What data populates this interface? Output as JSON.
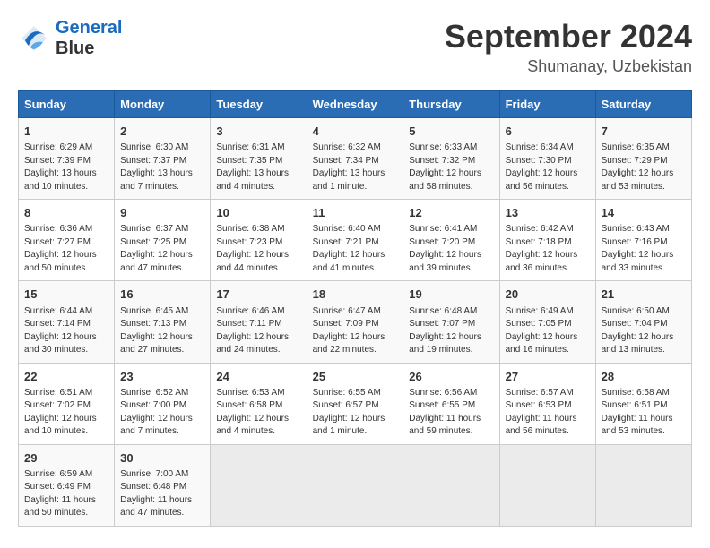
{
  "header": {
    "logo_line1": "General",
    "logo_line2": "Blue",
    "month": "September 2024",
    "location": "Shumanay, Uzbekistan"
  },
  "weekdays": [
    "Sunday",
    "Monday",
    "Tuesday",
    "Wednesday",
    "Thursday",
    "Friday",
    "Saturday"
  ],
  "weeks": [
    [
      {
        "day": "1",
        "info": "Sunrise: 6:29 AM\nSunset: 7:39 PM\nDaylight: 13 hours\nand 10 minutes."
      },
      {
        "day": "2",
        "info": "Sunrise: 6:30 AM\nSunset: 7:37 PM\nDaylight: 13 hours\nand 7 minutes."
      },
      {
        "day": "3",
        "info": "Sunrise: 6:31 AM\nSunset: 7:35 PM\nDaylight: 13 hours\nand 4 minutes."
      },
      {
        "day": "4",
        "info": "Sunrise: 6:32 AM\nSunset: 7:34 PM\nDaylight: 13 hours\nand 1 minute."
      },
      {
        "day": "5",
        "info": "Sunrise: 6:33 AM\nSunset: 7:32 PM\nDaylight: 12 hours\nand 58 minutes."
      },
      {
        "day": "6",
        "info": "Sunrise: 6:34 AM\nSunset: 7:30 PM\nDaylight: 12 hours\nand 56 minutes."
      },
      {
        "day": "7",
        "info": "Sunrise: 6:35 AM\nSunset: 7:29 PM\nDaylight: 12 hours\nand 53 minutes."
      }
    ],
    [
      {
        "day": "8",
        "info": "Sunrise: 6:36 AM\nSunset: 7:27 PM\nDaylight: 12 hours\nand 50 minutes."
      },
      {
        "day": "9",
        "info": "Sunrise: 6:37 AM\nSunset: 7:25 PM\nDaylight: 12 hours\nand 47 minutes."
      },
      {
        "day": "10",
        "info": "Sunrise: 6:38 AM\nSunset: 7:23 PM\nDaylight: 12 hours\nand 44 minutes."
      },
      {
        "day": "11",
        "info": "Sunrise: 6:40 AM\nSunset: 7:21 PM\nDaylight: 12 hours\nand 41 minutes."
      },
      {
        "day": "12",
        "info": "Sunrise: 6:41 AM\nSunset: 7:20 PM\nDaylight: 12 hours\nand 39 minutes."
      },
      {
        "day": "13",
        "info": "Sunrise: 6:42 AM\nSunset: 7:18 PM\nDaylight: 12 hours\nand 36 minutes."
      },
      {
        "day": "14",
        "info": "Sunrise: 6:43 AM\nSunset: 7:16 PM\nDaylight: 12 hours\nand 33 minutes."
      }
    ],
    [
      {
        "day": "15",
        "info": "Sunrise: 6:44 AM\nSunset: 7:14 PM\nDaylight: 12 hours\nand 30 minutes."
      },
      {
        "day": "16",
        "info": "Sunrise: 6:45 AM\nSunset: 7:13 PM\nDaylight: 12 hours\nand 27 minutes."
      },
      {
        "day": "17",
        "info": "Sunrise: 6:46 AM\nSunset: 7:11 PM\nDaylight: 12 hours\nand 24 minutes."
      },
      {
        "day": "18",
        "info": "Sunrise: 6:47 AM\nSunset: 7:09 PM\nDaylight: 12 hours\nand 22 minutes."
      },
      {
        "day": "19",
        "info": "Sunrise: 6:48 AM\nSunset: 7:07 PM\nDaylight: 12 hours\nand 19 minutes."
      },
      {
        "day": "20",
        "info": "Sunrise: 6:49 AM\nSunset: 7:05 PM\nDaylight: 12 hours\nand 16 minutes."
      },
      {
        "day": "21",
        "info": "Sunrise: 6:50 AM\nSunset: 7:04 PM\nDaylight: 12 hours\nand 13 minutes."
      }
    ],
    [
      {
        "day": "22",
        "info": "Sunrise: 6:51 AM\nSunset: 7:02 PM\nDaylight: 12 hours\nand 10 minutes."
      },
      {
        "day": "23",
        "info": "Sunrise: 6:52 AM\nSunset: 7:00 PM\nDaylight: 12 hours\nand 7 minutes."
      },
      {
        "day": "24",
        "info": "Sunrise: 6:53 AM\nSunset: 6:58 PM\nDaylight: 12 hours\nand 4 minutes."
      },
      {
        "day": "25",
        "info": "Sunrise: 6:55 AM\nSunset: 6:57 PM\nDaylight: 12 hours\nand 1 minute."
      },
      {
        "day": "26",
        "info": "Sunrise: 6:56 AM\nSunset: 6:55 PM\nDaylight: 11 hours\nand 59 minutes."
      },
      {
        "day": "27",
        "info": "Sunrise: 6:57 AM\nSunset: 6:53 PM\nDaylight: 11 hours\nand 56 minutes."
      },
      {
        "day": "28",
        "info": "Sunrise: 6:58 AM\nSunset: 6:51 PM\nDaylight: 11 hours\nand 53 minutes."
      }
    ],
    [
      {
        "day": "29",
        "info": "Sunrise: 6:59 AM\nSunset: 6:49 PM\nDaylight: 11 hours\nand 50 minutes."
      },
      {
        "day": "30",
        "info": "Sunrise: 7:00 AM\nSunset: 6:48 PM\nDaylight: 11 hours\nand 47 minutes."
      },
      {
        "day": "",
        "info": ""
      },
      {
        "day": "",
        "info": ""
      },
      {
        "day": "",
        "info": ""
      },
      {
        "day": "",
        "info": ""
      },
      {
        "day": "",
        "info": ""
      }
    ]
  ]
}
